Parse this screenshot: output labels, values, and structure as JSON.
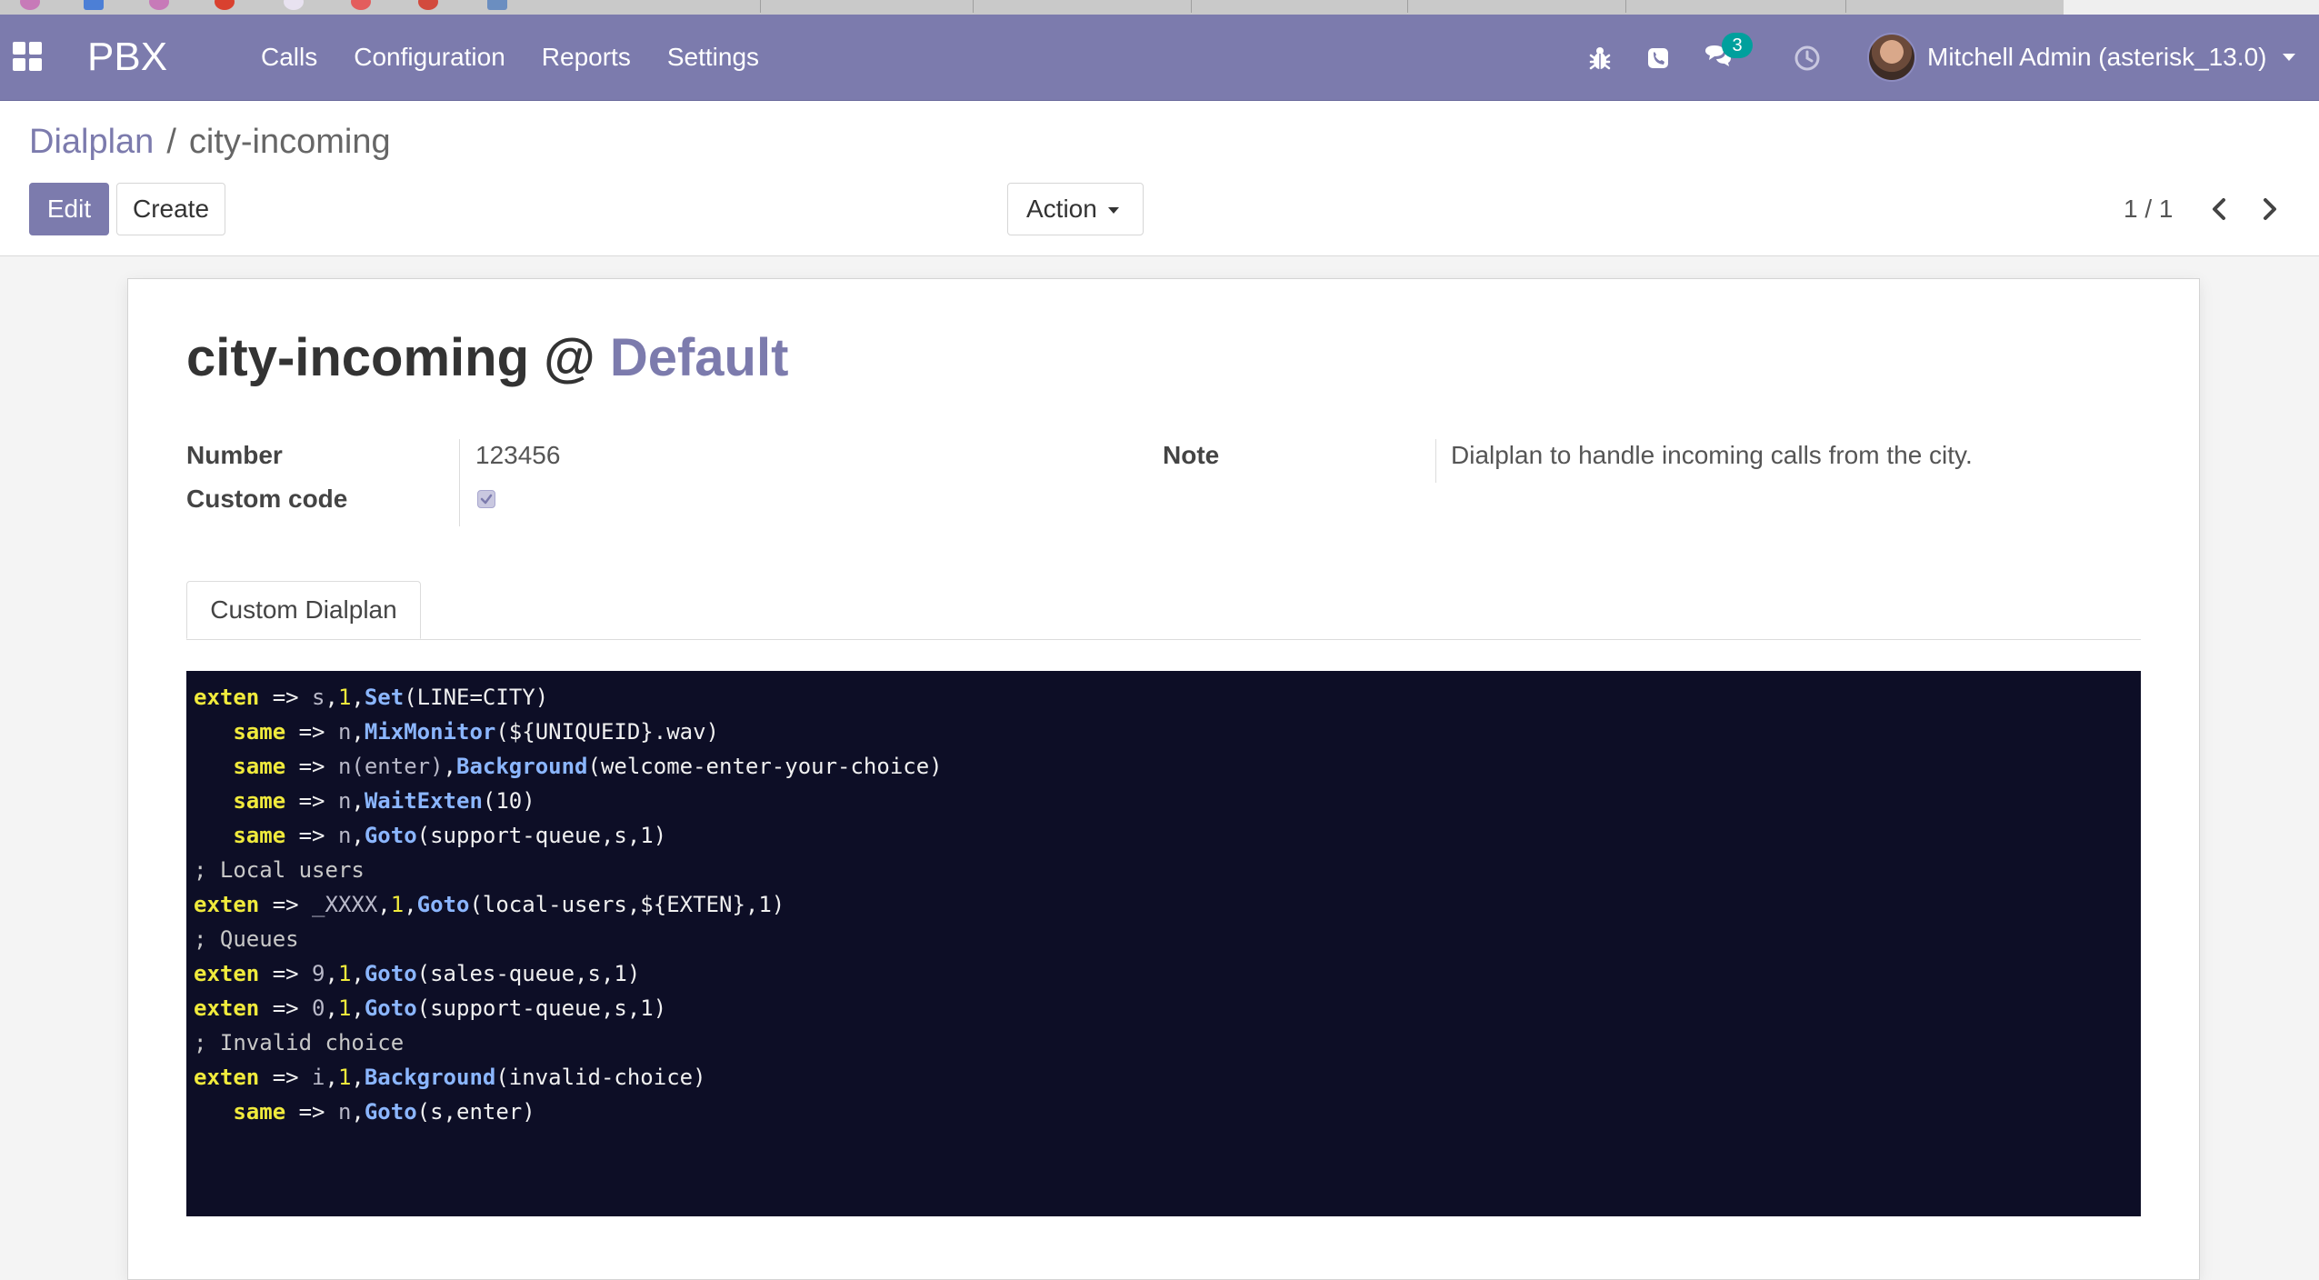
{
  "navbar": {
    "brand": "PBX",
    "menu": [
      "Calls",
      "Configuration",
      "Reports",
      "Settings"
    ],
    "chat_badge": "3",
    "user_name": "Mitchell Admin (asterisk_13.0)"
  },
  "control_panel": {
    "breadcrumb_parent": "Dialplan",
    "breadcrumb_separator": "/",
    "breadcrumb_current": "city-incoming",
    "edit_label": "Edit",
    "create_label": "Create",
    "action_label": "Action",
    "pager": "1 / 1"
  },
  "form": {
    "title_name": "city-incoming",
    "title_at": "@",
    "title_context": "Default",
    "number_label": "Number",
    "number_value": "123456",
    "custom_code_label": "Custom code",
    "custom_code_checked": true,
    "note_label": "Note",
    "note_value": "Dialplan to handle incoming calls from the city.",
    "tab_label": "Custom Dialplan"
  },
  "code_lines": [
    [
      {
        "t": "exten",
        "c": "kw"
      },
      {
        "t": " => ",
        "c": "plain"
      },
      {
        "t": "s",
        "c": "dim"
      },
      {
        "t": ",",
        "c": "plain"
      },
      {
        "t": "1",
        "c": "num"
      },
      {
        "t": ",",
        "c": "plain"
      },
      {
        "t": "Set",
        "c": "fn"
      },
      {
        "t": "(LINE=CITY)",
        "c": "plain"
      }
    ],
    [
      {
        "t": "   same",
        "c": "kw"
      },
      {
        "t": " => ",
        "c": "plain"
      },
      {
        "t": "n",
        "c": "dim"
      },
      {
        "t": ",",
        "c": "plain"
      },
      {
        "t": "MixMonitor",
        "c": "fn"
      },
      {
        "t": "(${UNIQUEID}.wav)",
        "c": "plain"
      }
    ],
    [
      {
        "t": "   same",
        "c": "kw"
      },
      {
        "t": " => ",
        "c": "plain"
      },
      {
        "t": "n(enter)",
        "c": "dim"
      },
      {
        "t": ",",
        "c": "plain"
      },
      {
        "t": "Background",
        "c": "fn"
      },
      {
        "t": "(welcome-enter-your-choice)",
        "c": "plain"
      }
    ],
    [
      {
        "t": "   same",
        "c": "kw"
      },
      {
        "t": " => ",
        "c": "plain"
      },
      {
        "t": "n",
        "c": "dim"
      },
      {
        "t": ",",
        "c": "plain"
      },
      {
        "t": "WaitExten",
        "c": "fn"
      },
      {
        "t": "(10)",
        "c": "plain"
      }
    ],
    [
      {
        "t": "   same",
        "c": "kw"
      },
      {
        "t": " => ",
        "c": "plain"
      },
      {
        "t": "n",
        "c": "dim"
      },
      {
        "t": ",",
        "c": "plain"
      },
      {
        "t": "Goto",
        "c": "fn"
      },
      {
        "t": "(support-queue,s,1)",
        "c": "plain"
      }
    ],
    [
      {
        "t": "; Local users",
        "c": "cmt"
      }
    ],
    [
      {
        "t": "exten",
        "c": "kw"
      },
      {
        "t": " => ",
        "c": "plain"
      },
      {
        "t": "_XXXX",
        "c": "dim"
      },
      {
        "t": ",",
        "c": "plain"
      },
      {
        "t": "1",
        "c": "num"
      },
      {
        "t": ",",
        "c": "plain"
      },
      {
        "t": "Goto",
        "c": "fn"
      },
      {
        "t": "(local-users,${EXTEN},1)",
        "c": "plain"
      }
    ],
    [
      {
        "t": "; Queues",
        "c": "cmt"
      }
    ],
    [
      {
        "t": "exten",
        "c": "kw"
      },
      {
        "t": " => ",
        "c": "plain"
      },
      {
        "t": "9",
        "c": "dim"
      },
      {
        "t": ",",
        "c": "plain"
      },
      {
        "t": "1",
        "c": "num"
      },
      {
        "t": ",",
        "c": "plain"
      },
      {
        "t": "Goto",
        "c": "fn"
      },
      {
        "t": "(sales-queue,s,1)",
        "c": "plain"
      }
    ],
    [
      {
        "t": "exten",
        "c": "kw"
      },
      {
        "t": " => ",
        "c": "plain"
      },
      {
        "t": "0",
        "c": "dim"
      },
      {
        "t": ",",
        "c": "plain"
      },
      {
        "t": "1",
        "c": "num"
      },
      {
        "t": ",",
        "c": "plain"
      },
      {
        "t": "Goto",
        "c": "fn"
      },
      {
        "t": "(support-queue,s,1)",
        "c": "plain"
      }
    ],
    [
      {
        "t": "; Invalid choice",
        "c": "cmt"
      }
    ],
    [
      {
        "t": "exten",
        "c": "kw"
      },
      {
        "t": " => ",
        "c": "plain"
      },
      {
        "t": "i",
        "c": "dim"
      },
      {
        "t": ",",
        "c": "plain"
      },
      {
        "t": "1",
        "c": "num"
      },
      {
        "t": ",",
        "c": "plain"
      },
      {
        "t": "Background",
        "c": "fn"
      },
      {
        "t": "(invalid-choice)",
        "c": "plain"
      }
    ],
    [
      {
        "t": "   same",
        "c": "kw"
      },
      {
        "t": " => ",
        "c": "plain"
      },
      {
        "t": "n",
        "c": "dim"
      },
      {
        "t": ",",
        "c": "plain"
      },
      {
        "t": "Goto",
        "c": "fn"
      },
      {
        "t": "(s,enter)",
        "c": "plain"
      }
    ]
  ],
  "colors": {
    "brand": "#7c7bad",
    "code_bg": "#0d0e26",
    "code_keyword": "#f0ea3c",
    "code_function": "#8bb6ff",
    "badge": "#00a09d"
  },
  "icons": {
    "apps": "apps-grid-icon",
    "debug": "bug-icon",
    "phone": "phone-icon",
    "chat": "chat-icon",
    "activity": "clock-icon",
    "user_menu": "caret-down-icon",
    "pager_prev": "chevron-left-icon",
    "pager_next": "chevron-right-icon"
  }
}
